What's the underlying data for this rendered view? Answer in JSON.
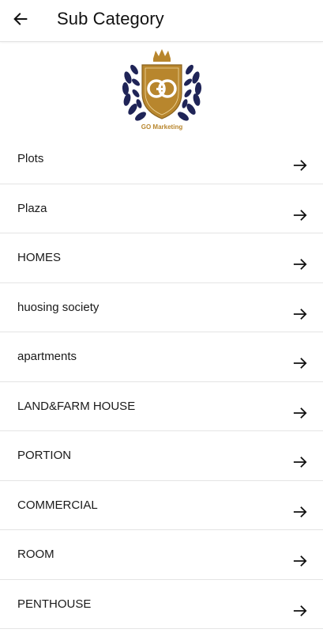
{
  "header": {
    "title": "Sub Category",
    "back_icon": "arrow-left-icon"
  },
  "logo": {
    "caption": "GO Marketing",
    "monogram": "GO",
    "colors": {
      "gold": "#b8862d",
      "navy": "#1f2457"
    }
  },
  "categories": [
    {
      "label": "Plots"
    },
    {
      "label": "Plaza"
    },
    {
      "label": "HOMES"
    },
    {
      "label": "huosing society"
    },
    {
      "label": "apartments"
    },
    {
      "label": "LAND&FARM HOUSE"
    },
    {
      "label": "PORTION"
    },
    {
      "label": "COMMERCIAL"
    },
    {
      "label": "ROOM"
    },
    {
      "label": "PENTHOUSE"
    }
  ],
  "row_icon": "arrow-right-icon"
}
